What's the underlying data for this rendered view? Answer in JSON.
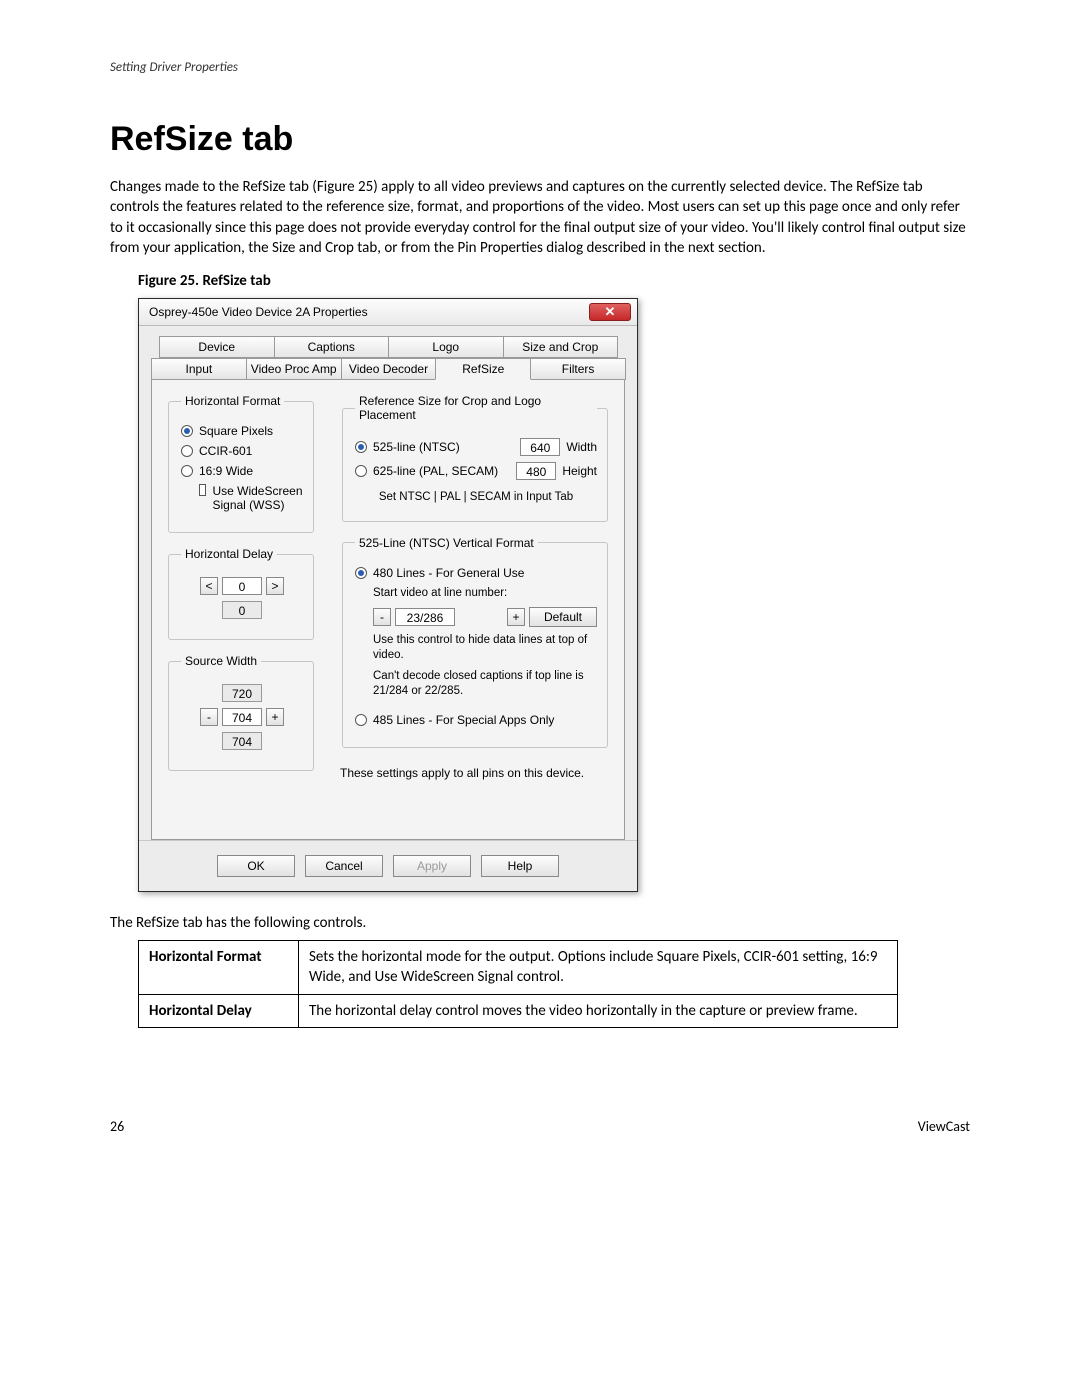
{
  "page_header": "Setting Driver Properties",
  "title": "RefSize tab",
  "intro": "Changes made to the RefSize tab (Figure 25) apply to all video previews and captures on the currently selected device. The RefSize tab controls the features related to the reference size, format, and proportions of the video. Most users can set up this page once and only refer to it occasionally since this page does not provide everyday control for the final output size of your video. You'll likely control final output size from your application, the Size and Crop tab, or from the Pin Properties dialog described in the next section.",
  "figure_caption": "Figure 25. RefSize tab",
  "dialog": {
    "title": "Osprey-450e Video Device 2A Properties",
    "tabs_back": [
      "Device",
      "Captions",
      "Logo",
      "Size and Crop"
    ],
    "tabs_front": [
      "Input",
      "Video Proc Amp",
      "Video Decoder",
      "RefSize",
      "Filters"
    ],
    "selected_tab": "RefSize",
    "horiz_format": {
      "legend": "Horizontal Format",
      "opt_square": "Square Pixels",
      "opt_ccir": "CCIR-601",
      "opt_169": "16:9 Wide",
      "chk_wss": "Use WideScreen Signal (WSS)"
    },
    "refsize": {
      "legend": "Reference Size for Crop and Logo Placement",
      "opt_525": "525-line (NTSC)",
      "opt_625": "625-line (PAL, SECAM)",
      "width_val": "640",
      "width_lbl": "Width",
      "height_val": "480",
      "height_lbl": "Height",
      "hint_set": "Set NTSC | PAL | SECAM in Input Tab"
    },
    "hdelay": {
      "legend": "Horizontal Delay",
      "value": "0",
      "reset": "0"
    },
    "srcwidth": {
      "legend": "Source Width",
      "max": "720",
      "val": "704",
      "reset": "704"
    },
    "vformat": {
      "legend": "525-Line (NTSC) Vertical Format",
      "opt_480": "480 Lines - For General Use",
      "start_lbl": "Start video at line number:",
      "start_val": "23/286",
      "default_btn": "Default",
      "hint1": "Use this control to hide data lines at top of video.",
      "hint2": "Can't decode closed captions if top line is 21/284 or 22/285.",
      "opt_485": "485 Lines - For Special Apps Only"
    },
    "note": "These settings apply to all pins on this device.",
    "buttons": {
      "ok": "OK",
      "cancel": "Cancel",
      "apply": "Apply",
      "help": "Help"
    }
  },
  "table_lead": "The RefSize tab has the following controls.",
  "table_rows": [
    {
      "name": "Horizontal Format",
      "desc": "Sets the horizontal mode for the output. Options include Square Pixels, CCIR-601 setting, 16:9 Wide, and Use WideScreen Signal control."
    },
    {
      "name": "Horizontal Delay",
      "desc": "The horizontal delay control moves the video horizontally in the capture or preview frame."
    }
  ],
  "footer": {
    "page": "26",
    "brand": "ViewCast"
  }
}
